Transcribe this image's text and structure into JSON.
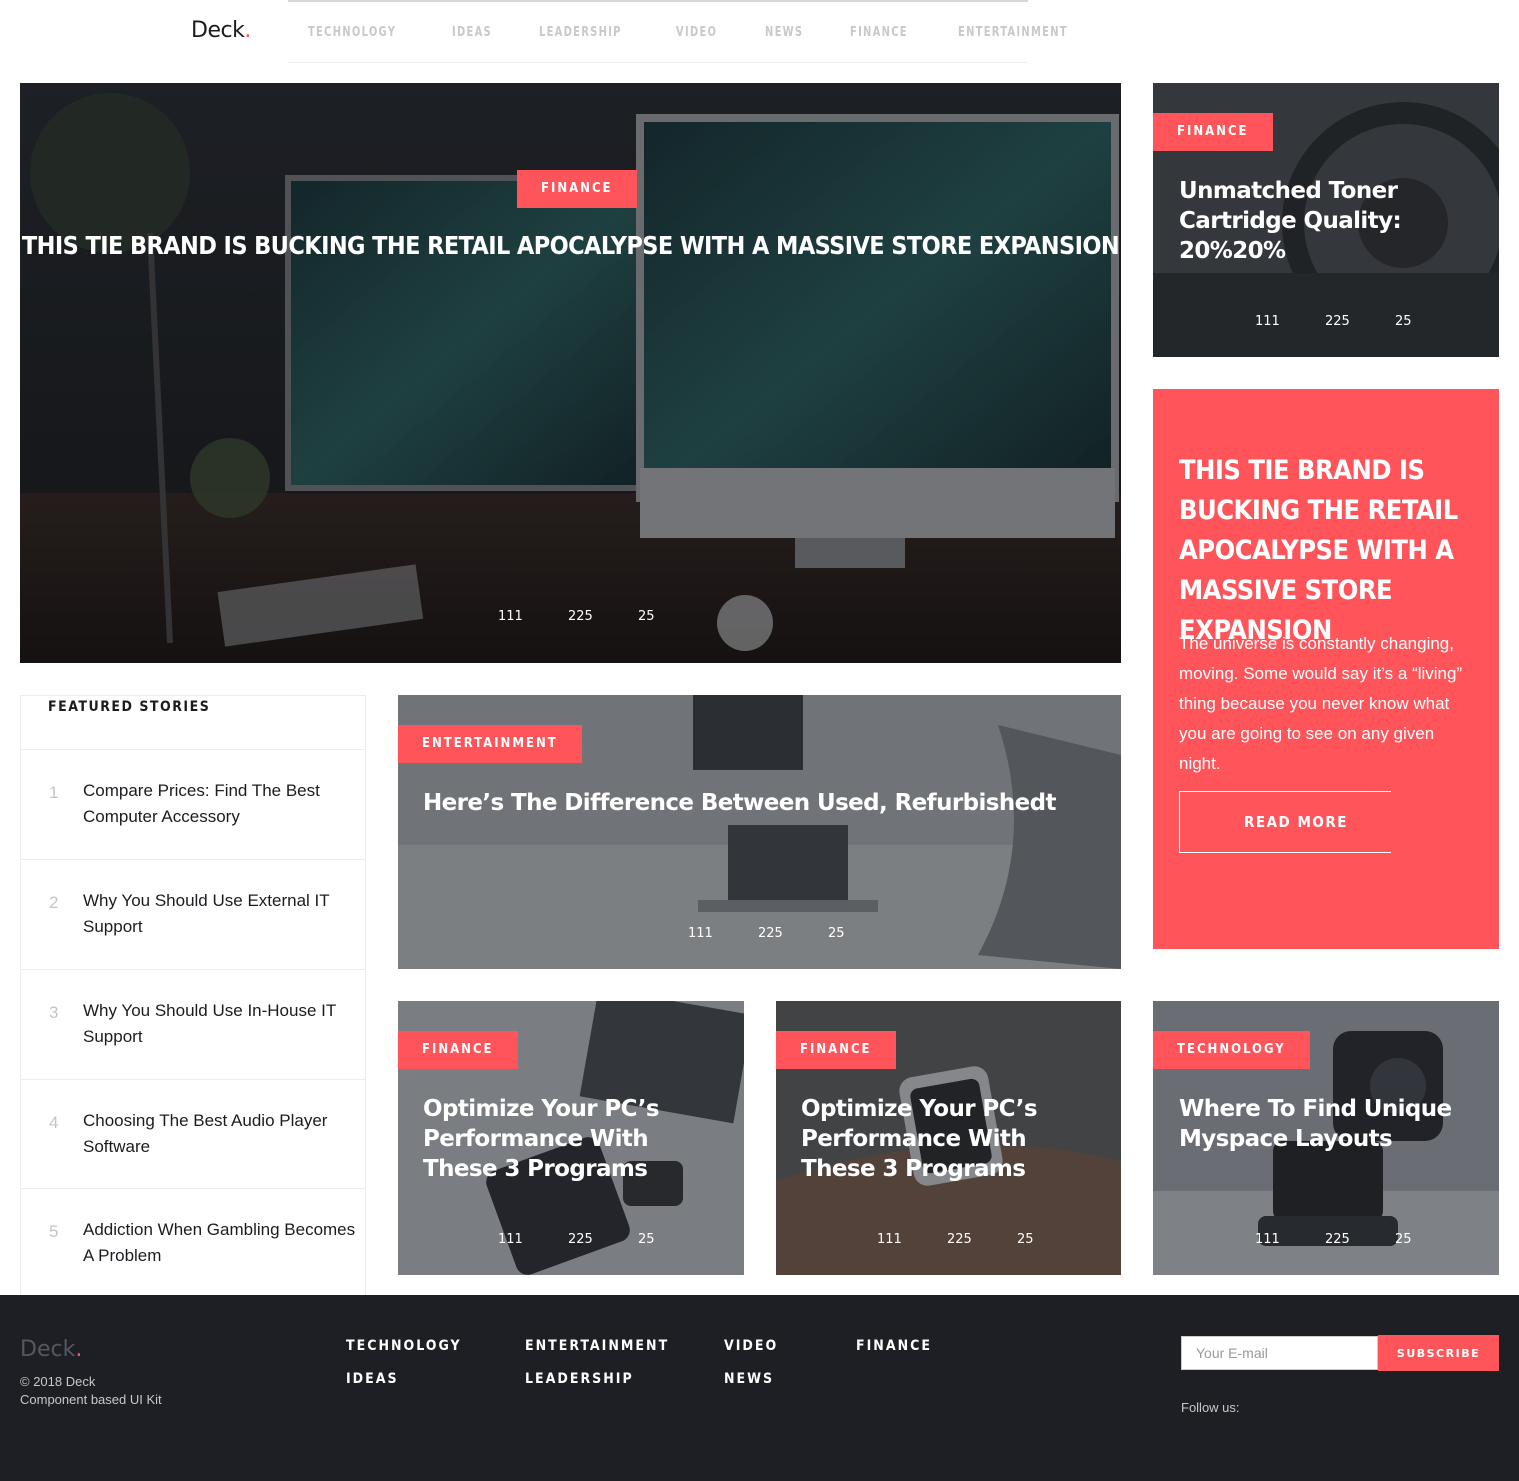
{
  "brand": {
    "name": "Deck",
    "dot": "."
  },
  "nav": [
    "TECHNOLOGY",
    "IDEAS",
    "LEADERSHIP",
    "VIDEO",
    "NEWS",
    "FINANCE",
    "ENTERTAINMENT"
  ],
  "hero": {
    "tag": "FINANCE",
    "title": "THIS TIE BRAND IS BUCKING THE RETAIL APOCALYPSE WITH A MASSIVE STORE EXPANSION",
    "stats": [
      "111",
      "225",
      "25"
    ]
  },
  "side_card": {
    "tag": "FINANCE",
    "title": "Unmatched Toner Cartridge Quality: 20%20%",
    "stats": [
      "111",
      "225",
      "25"
    ]
  },
  "promo": {
    "title": "THIS TIE BRAND IS BUCKING THE RETAIL APOCALYPSE WITH A MASSIVE STORE EXPANSION",
    "body": "The universe is constantly changing, moving. Some would say it’s a “living” thing because you never know what you are going to see on any given night.",
    "button": "READ MORE"
  },
  "featured": {
    "heading": "FEATURED STORIES",
    "items": [
      {
        "num": "1",
        "text": "Compare Prices: Find The Best Computer Accessory"
      },
      {
        "num": "2",
        "text": "Why You Should Use External IT Support"
      },
      {
        "num": "3",
        "text": "Why You Should Use In-House IT Support"
      },
      {
        "num": "4",
        "text": "Choosing The Best Audio Player Software"
      },
      {
        "num": "5",
        "text": "Addiction When Gambling Becomes A Problem"
      }
    ]
  },
  "mid_card": {
    "tag": "ENTERTAINMENT",
    "title": "Here’s The Difference Between Used, Refurbishedt",
    "stats": [
      "111",
      "225",
      "25"
    ]
  },
  "bottom_cards": [
    {
      "tag": "FINANCE",
      "title": "Optimize Your PC’s Performance With These 3 Programs",
      "stats": [
        "111",
        "225",
        "25"
      ]
    },
    {
      "tag": "FINANCE",
      "title": "Optimize Your PC’s Performance With These 3 Programs",
      "stats": [
        "111",
        "225",
        "25"
      ]
    },
    {
      "tag": "TECHNOLOGY",
      "title": "Where To Find Unique Myspace Layouts",
      "stats": [
        "111",
        "225",
        "25"
      ]
    }
  ],
  "footer": {
    "copyright": "© 2018 Deck",
    "tagline": "Component based UI Kit",
    "links": [
      "TECHNOLOGY",
      "IDEAS",
      "ENTERTAINMENT",
      "LEADERSHIP",
      "VIDEO",
      "NEWS",
      "FINANCE"
    ],
    "email_placeholder": "Your E-mail",
    "subscribe": "SUBSCRIBE",
    "follow": "Follow us:"
  },
  "colors": {
    "accent": "#ff5459",
    "dark": "#1e1f24",
    "text": "#1b1c20"
  }
}
